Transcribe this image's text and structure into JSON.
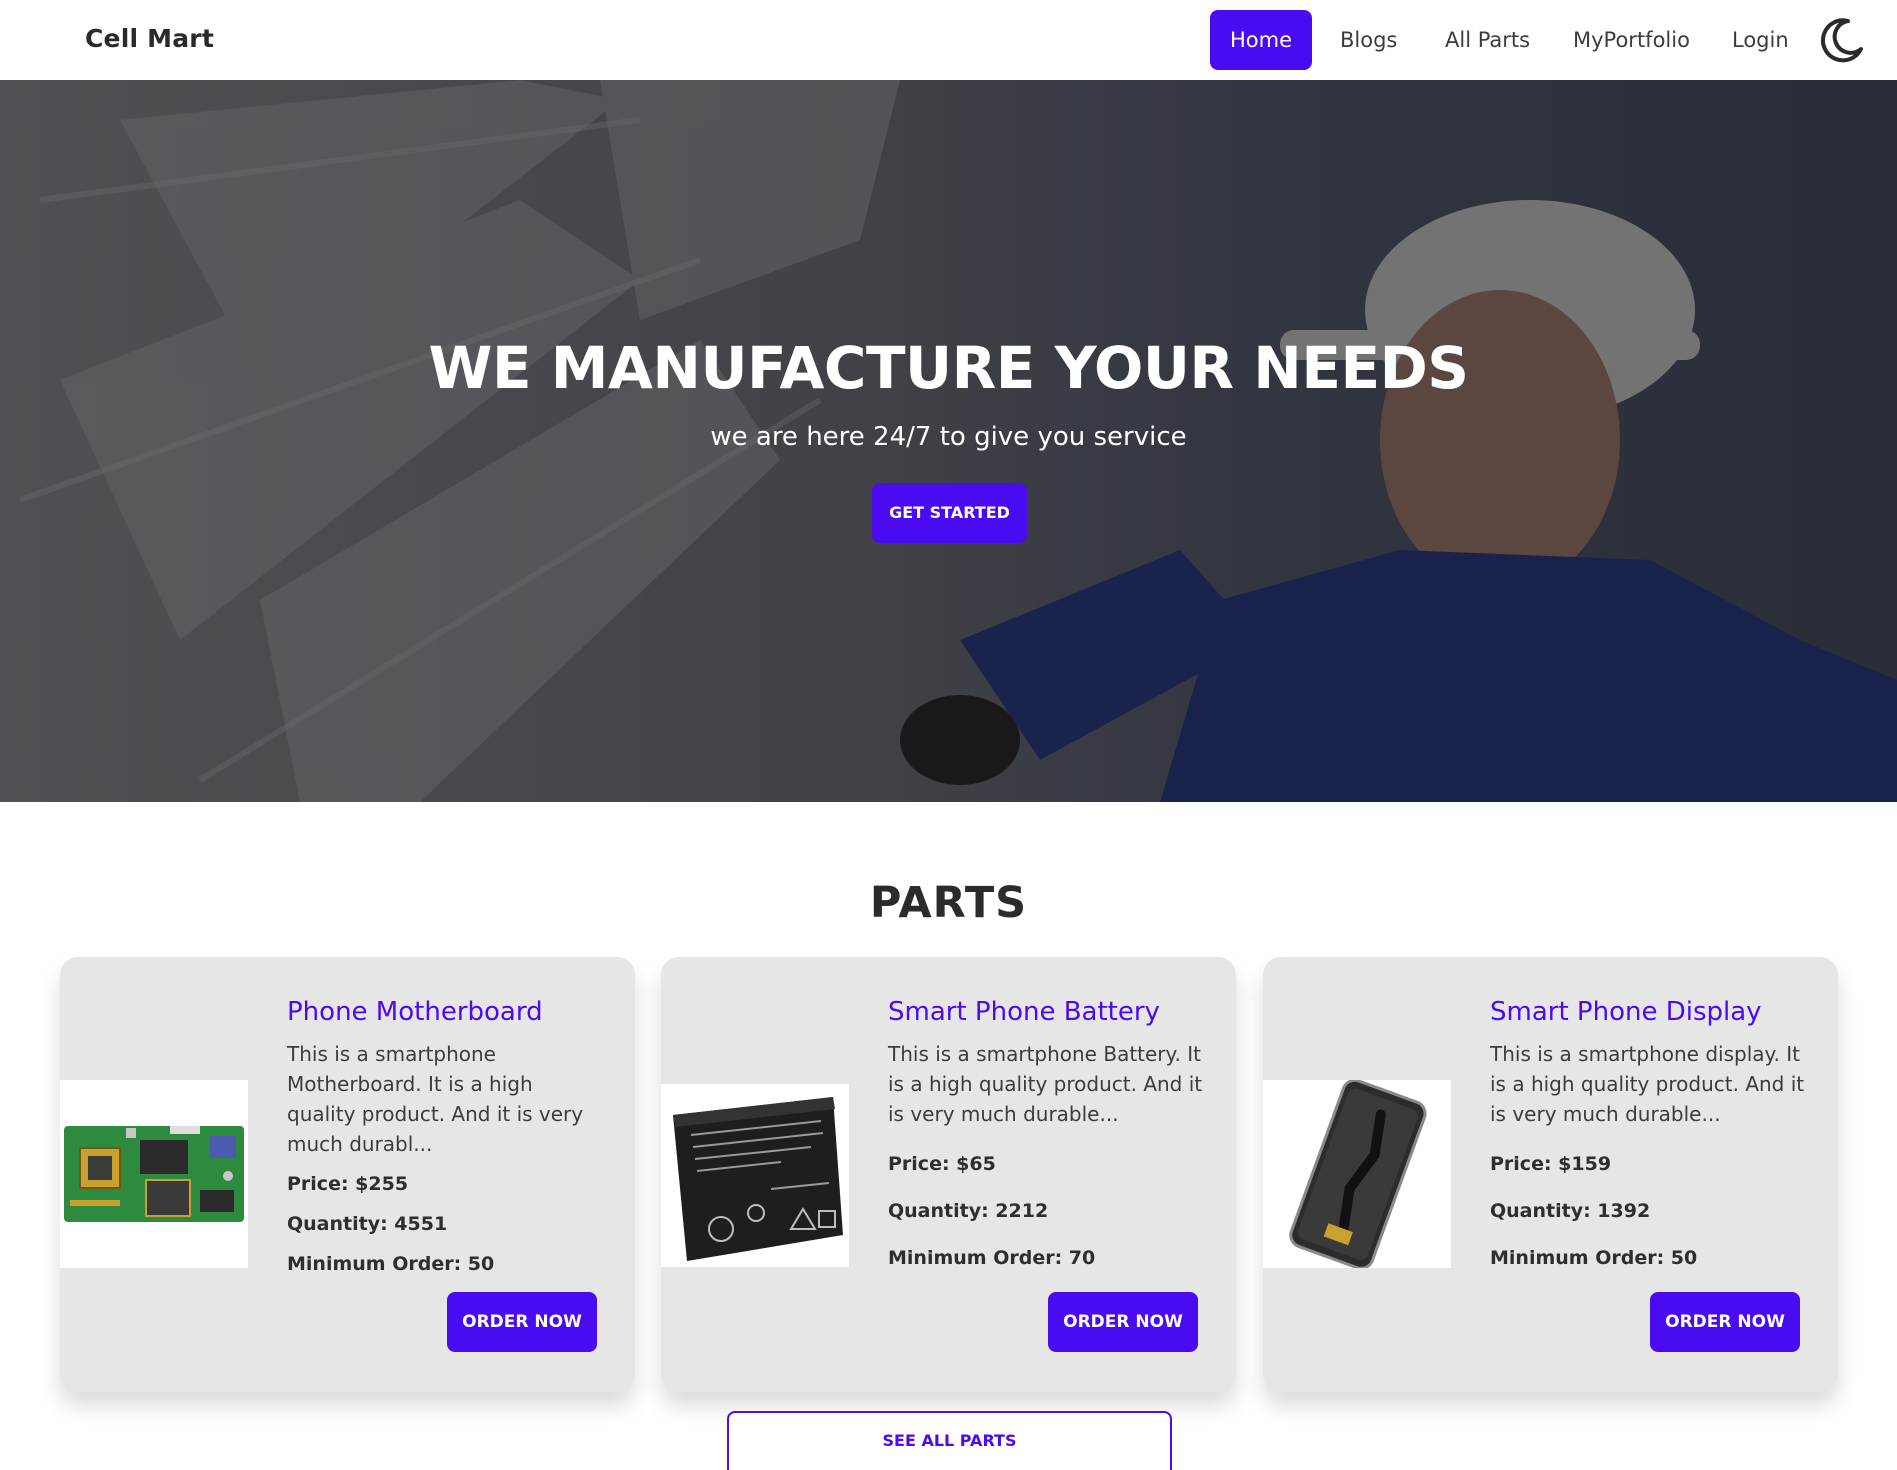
{
  "brand": "Cell Mart",
  "nav": {
    "items": [
      "Home",
      "Blogs",
      "All Parts",
      "MyPortfolio",
      "Login"
    ],
    "active": "Home",
    "theme_icon": "moon-icon"
  },
  "hero": {
    "title": "WE MANUFACTURE YOUR NEEDS",
    "subtitle": "we are here 24/7 to give you service",
    "button": "GET STARTED"
  },
  "parts": {
    "heading": "PARTS",
    "items": [
      {
        "name": "Phone Motherboard",
        "description": "This is a smartphone Motherboard. It is a high quality product. And it is very much durabl...",
        "price": "Price: $255",
        "quantity": "Quantity: 4551",
        "min_order": "Minimum Order: 50",
        "button": "ORDER NOW",
        "image": "motherboard-image"
      },
      {
        "name": "Smart Phone Battery",
        "description": "This is a smartphone Battery. It is a high quality product. And it is very much durable...",
        "price": "Price: $65",
        "quantity": "Quantity: 2212",
        "min_order": "Minimum Order: 70",
        "button": "ORDER NOW",
        "image": "battery-image"
      },
      {
        "name": "Smart Phone Display",
        "description": "This is a smartphone display. It is a high quality product. And it is very much durable...",
        "price": "Price: $159",
        "quantity": "Quantity: 1392",
        "min_order": "Minimum Order: 50",
        "button": "ORDER NOW",
        "image": "display-image"
      }
    ],
    "see_all": "SEE ALL PARTS"
  },
  "colors": {
    "accent": "#4a0bf0",
    "card_bg": "#e6e6e6",
    "text": "#2b2b2b"
  }
}
